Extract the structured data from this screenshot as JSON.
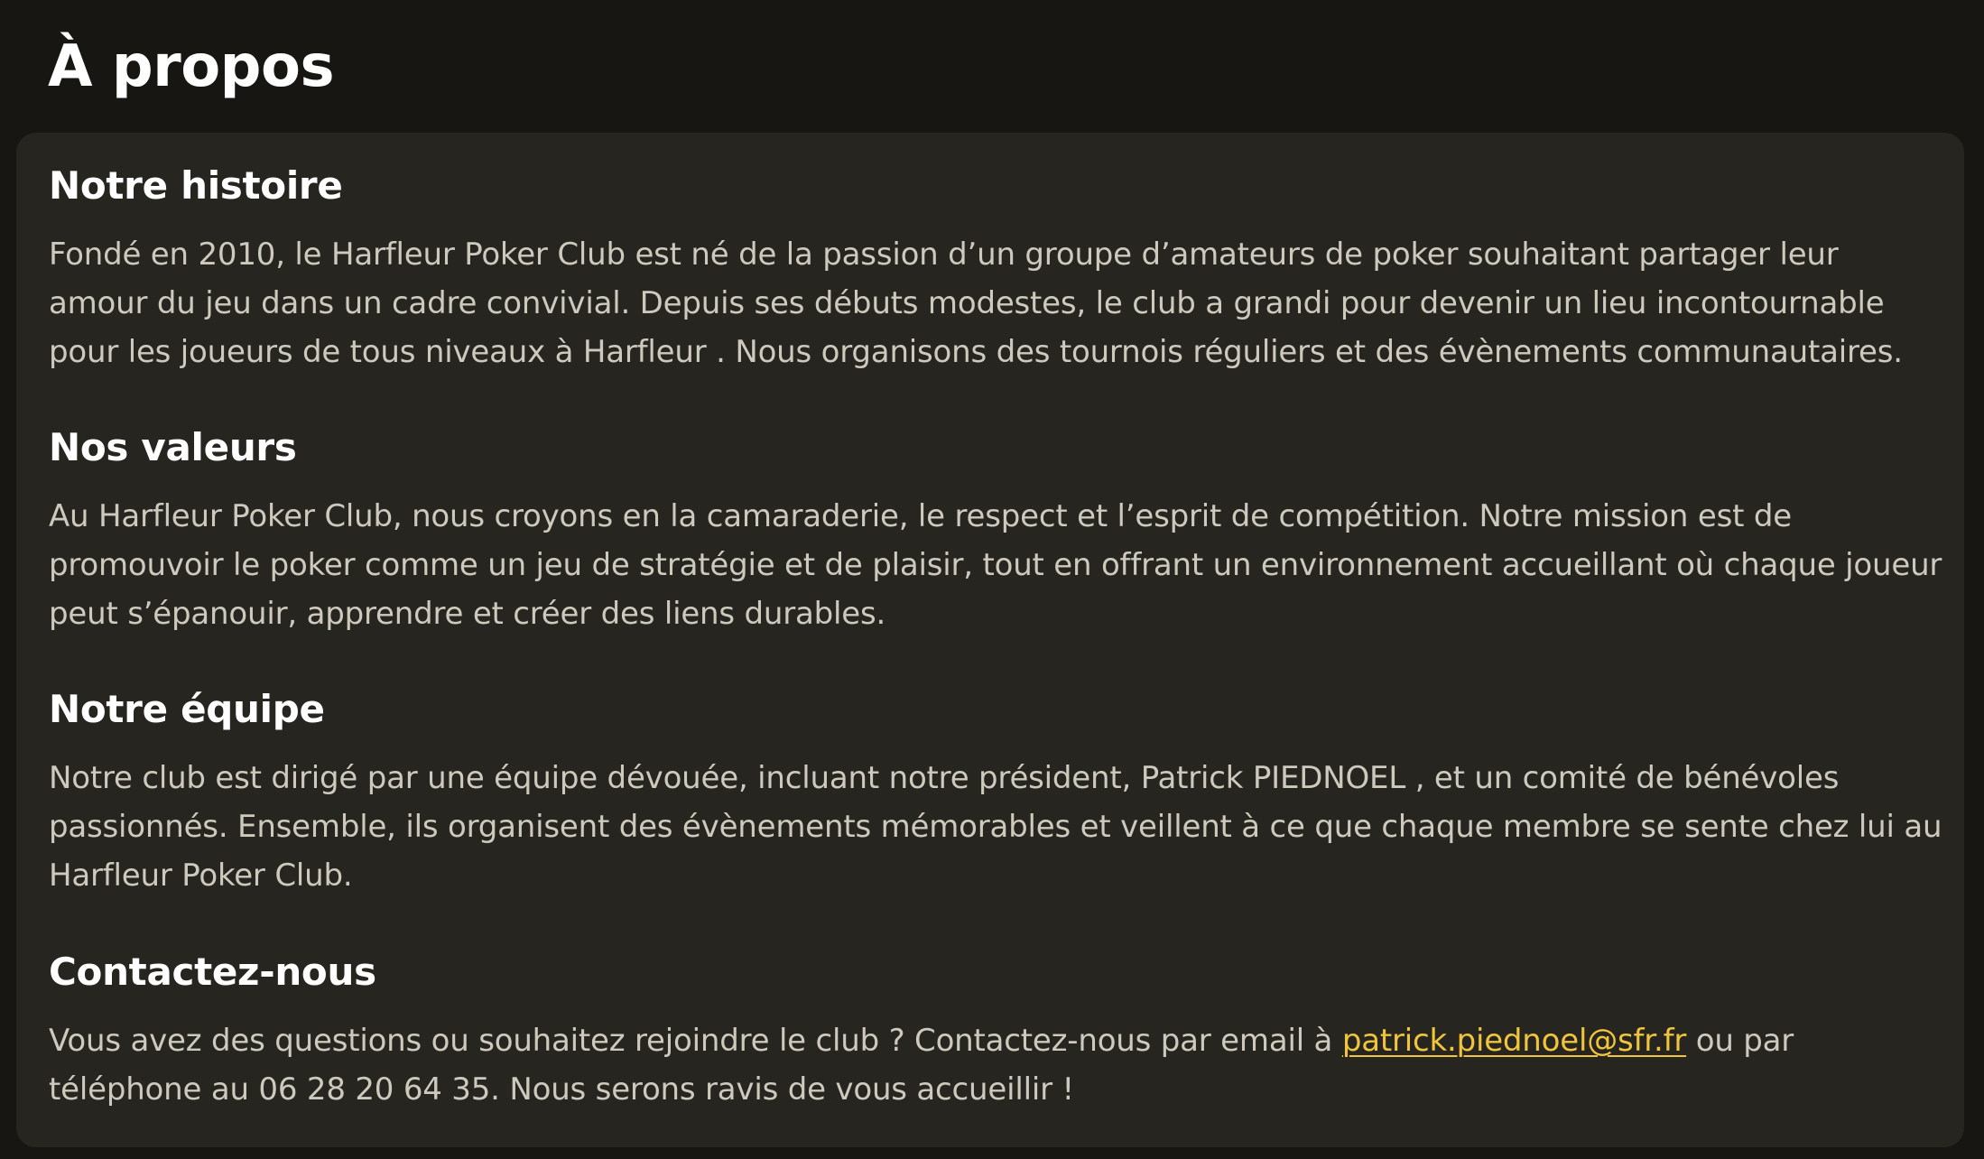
{
  "page": {
    "title": "À propos"
  },
  "sections": {
    "history": {
      "heading": "Notre histoire",
      "text": "Fondé en 2010, le Harfleur Poker Club est né de la passion d’un groupe d’amateurs de poker souhaitant partager leur amour du jeu dans un cadre convivial. Depuis ses débuts modestes, le club a grandi pour devenir un lieu incontournable pour les joueurs de tous niveaux à Harfleur . Nous organisons des tournois réguliers et des évènements communautaires."
    },
    "values": {
      "heading": "Nos valeurs",
      "text": "Au Harfleur Poker Club, nous croyons en la camaraderie, le respect et l’esprit de compétition. Notre mission est de promouvoir le poker comme un jeu de stratégie et de plaisir, tout en offrant un environnement accueillant où chaque joueur peut s’épanouir, apprendre et créer des liens durables."
    },
    "team": {
      "heading": "Notre équipe",
      "text": "Notre club est dirigé par une équipe dévouée, incluant notre président, Patrick PIEDNOEL , et un comité de bénévoles passionnés. Ensemble, ils organisent des évènements mémorables et veillent à ce que chaque membre se sente chez lui au Harfleur Poker Club."
    },
    "contact": {
      "heading": "Contactez-nous",
      "text_before": "Vous avez des questions ou souhaitez rejoindre le club ? Contactez-nous par email à ",
      "email": "patrick.piednoel@sfr.fr",
      "email_href": "mailto:patrick.piednoel@sfr.fr",
      "text_after": " ou par téléphone au 06 28 20 64 35. Nous serons ravis de vous accueillir !"
    }
  },
  "colors": {
    "background": "#171612",
    "card": "#27251f",
    "heading": "#ffffff",
    "body_text": "#cdc9bd",
    "link": "#f0c43c"
  }
}
